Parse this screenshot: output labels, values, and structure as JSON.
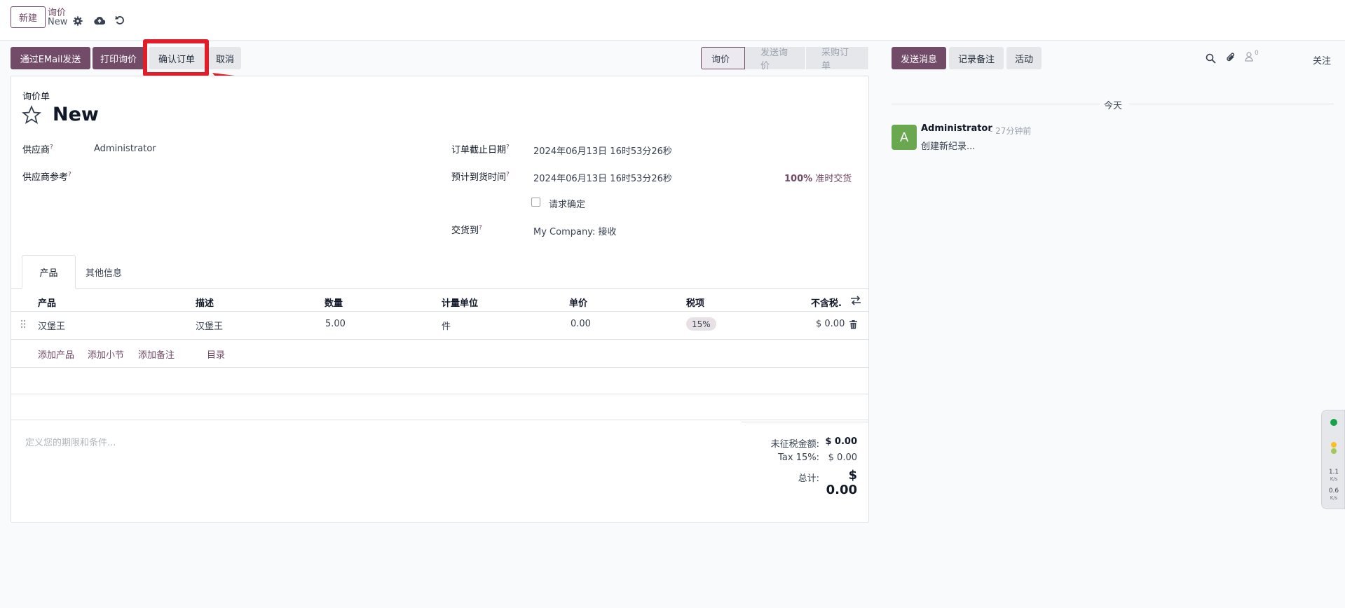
{
  "topbar": {
    "new_button": "新建",
    "breadcrumb_parent": "询价",
    "breadcrumb_current": "New"
  },
  "actions": {
    "send_email": "通过EMail发送",
    "print_rfq": "打印询价",
    "confirm_order": "确认订单",
    "cancel": "取消"
  },
  "status_stages": [
    {
      "label": "询价",
      "active": true
    },
    {
      "label": "发送询价",
      "active": false
    },
    {
      "label": "采购订单",
      "active": false
    }
  ],
  "form": {
    "doc_type": "询价单",
    "title": "New",
    "vendor_label": "供应商",
    "vendor_value": "Administrator",
    "vendor_ref_label": "供应商参考",
    "deadline_label": "订单截止日期",
    "deadline_value": "2024年06月13日 16时53分26秒",
    "expected_arrival_label": "预计到货时间",
    "expected_arrival_value": "2024年06月13日 16时53分26秒",
    "on_time_rate": "100%",
    "on_time_label": "准时交货",
    "ask_confirmation_label": "请求确定",
    "deliver_to_label": "交货到",
    "deliver_to_value": "My Company: 接收",
    "help_mark": "?"
  },
  "tabs": [
    "产品",
    "其他信息"
  ],
  "table": {
    "headers": {
      "product": "产品",
      "description": "描述",
      "quantity": "数量",
      "uom": "计量单位",
      "unit_price": "单价",
      "taxes": "税项",
      "subtotal": "不含税."
    },
    "rows": [
      {
        "product": "汉堡王",
        "description": "汉堡王",
        "quantity": "5.00",
        "uom": "件",
        "unit_price": "0.00",
        "tax": "15%",
        "subtotal": "$ 0.00"
      }
    ],
    "add_links": {
      "add_product": "添加产品",
      "add_section": "添加小节",
      "add_note": "添加备注",
      "catalog": "目录"
    }
  },
  "terms_placeholder": "定义您的期限和条件...",
  "totals": {
    "untaxed_label": "未征税金额:",
    "untaxed_value": "$ 0.00",
    "tax_label": "Tax 15%:",
    "tax_value": "$ 0.00",
    "total_label": "总计:",
    "total_value": "$ 0.00"
  },
  "chatter": {
    "send_message": "发送消息",
    "log_note": "记录备注",
    "activities": "活动",
    "followers_count": "0",
    "follow": "关注",
    "date_separator": "今天",
    "messages": [
      {
        "avatar_letter": "A",
        "author": "Administrator",
        "time": "- 27分钟前",
        "body": "创建新纪录..."
      }
    ]
  },
  "side_widget": {
    "upload": "1.1",
    "download": "0.6",
    "unit": "K/s"
  },
  "colors": {
    "primary": "#714b67",
    "highlight": "#e11d2a",
    "avatar": "#6aa84f"
  }
}
